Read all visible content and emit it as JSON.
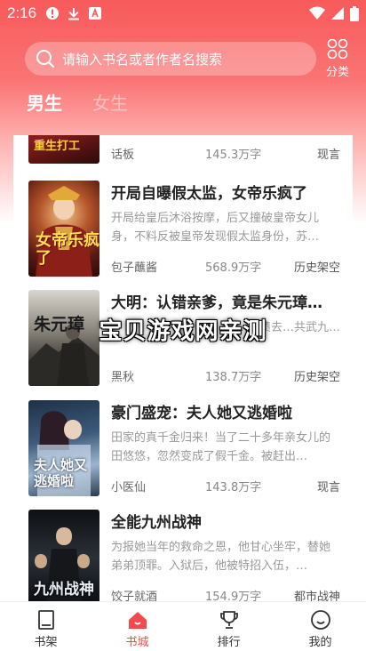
{
  "status": {
    "time": "2:16"
  },
  "search": {
    "placeholder": "请输入书名或者作者名搜索"
  },
  "category": {
    "label": "分类"
  },
  "gender_tabs": [
    {
      "label": "男生",
      "active": true
    },
    {
      "label": "女生",
      "active": false
    }
  ],
  "books": [
    {
      "title": "",
      "desc": "",
      "author": "话板",
      "words": "145.3万字",
      "tag": "现言",
      "cover_text": "重生打工"
    },
    {
      "title": "开局自曝假太监，女帝乐疯了",
      "desc": "开局给皇后沐浴按摩，后又撞破皇帝女儿身，不料反被皇帝发现假太监身份，苏…",
      "author": "包子蘸酱",
      "words": "568.9万字",
      "tag": "历史架空",
      "cover_text": "女帝乐疯了"
    },
    {
      "title": "大明：认错亲爹，竟是朱元璋…",
      "desc": "…赌债去…共武九…",
      "author": "黑秋",
      "words": "138.7万字",
      "tag": "历史架空",
      "cover_text": "朱元璋"
    },
    {
      "title": "豪门盛宠：夫人她又逃婚啦",
      "desc": "田家的真千金归来！当了二十多年亲女儿的田悠悠，忽然变成了假千金。被赶出…",
      "author": "小医仙",
      "words": "143.8万字",
      "tag": "现言",
      "cover_text": "夫人她又逃婚啦"
    },
    {
      "title": "全能九州战神",
      "desc": "为报她当年的救命之恩，他甘心坐牢，替她弟弟顶罪。入狱后，他被特招入伍，…",
      "author": "饺子就酒",
      "words": "154.9万字",
      "tag": "都市战神",
      "cover_text": "九州战神"
    }
  ],
  "watermark": "宝贝游戏网亲测",
  "nav": [
    {
      "label": "书架",
      "active": false
    },
    {
      "label": "书城",
      "active": true
    },
    {
      "label": "排行",
      "active": false
    },
    {
      "label": "我的",
      "active": false
    }
  ],
  "colors": {
    "accent": "#f24b4b",
    "header_top": "#f85a5a"
  }
}
